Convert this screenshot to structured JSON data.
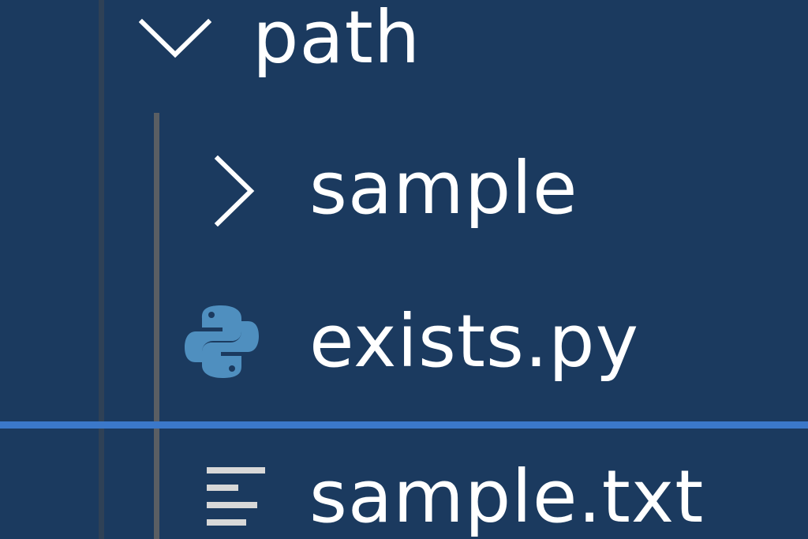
{
  "explorer": {
    "folder": {
      "label": "path",
      "state": "expanded",
      "icon": "chevron-down-icon"
    },
    "items": [
      {
        "label": "sample",
        "type": "folder",
        "state": "collapsed",
        "icon": "chevron-right-icon"
      },
      {
        "label": "exists.py",
        "type": "file",
        "icon": "python-icon"
      },
      {
        "label": "sample.txt",
        "type": "file",
        "icon": "text-file-icon"
      }
    ],
    "colors": {
      "background": "#1b3a5f",
      "text": "#ffffff",
      "drop_indicator": "#3b78c9",
      "python_icon": "#4f8fbf"
    }
  }
}
